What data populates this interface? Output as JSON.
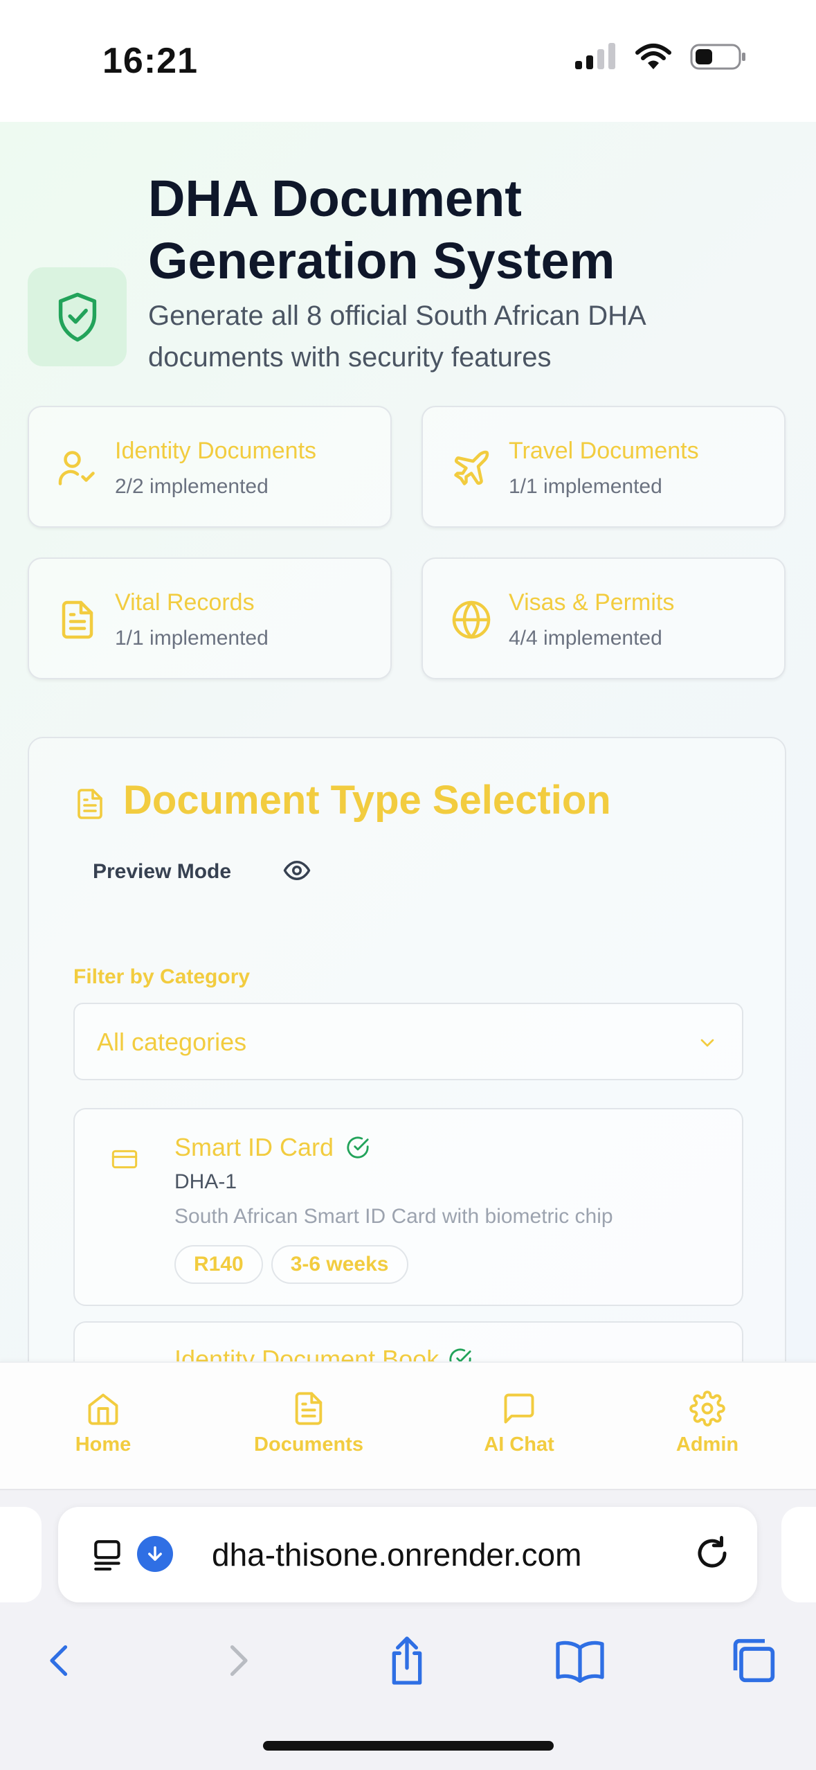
{
  "status_bar": {
    "time": "16:21"
  },
  "header": {
    "title": "DHA Document Generation System",
    "subtitle": "Generate all 8 official South African DHA documents with security features"
  },
  "stats": [
    {
      "title": "Identity Documents",
      "status": "2/2 implemented",
      "icon": "user-check-icon"
    },
    {
      "title": "Travel Documents",
      "status": "1/1 implemented",
      "icon": "plane-icon"
    },
    {
      "title": "Vital Records",
      "status": "1/1 implemented",
      "icon": "file-text-icon"
    },
    {
      "title": "Visas & Permits",
      "status": "4/4 implemented",
      "icon": "globe-icon"
    }
  ],
  "selection": {
    "title": "Document Type Selection",
    "preview_label": "Preview Mode",
    "filter_label": "Filter by Category",
    "filter_value": "All categories"
  },
  "documents": [
    {
      "name": "Smart ID Card",
      "code": "DHA-1",
      "description": "South African Smart ID Card with biometric chip",
      "price": "R140",
      "duration": "3-6 weeks"
    },
    {
      "name": "Identity Document Book"
    }
  ],
  "nav": [
    {
      "label": "Home",
      "icon": "home-icon"
    },
    {
      "label": "Documents",
      "icon": "document-icon"
    },
    {
      "label": "AI Chat",
      "icon": "chat-icon"
    },
    {
      "label": "Admin",
      "icon": "settings-icon"
    }
  ],
  "browser": {
    "url": "dha-thisone.onrender.com"
  },
  "colors": {
    "accent": "#f2cc3f",
    "success": "#22a35a",
    "browser_blue": "#2f6fe4"
  }
}
